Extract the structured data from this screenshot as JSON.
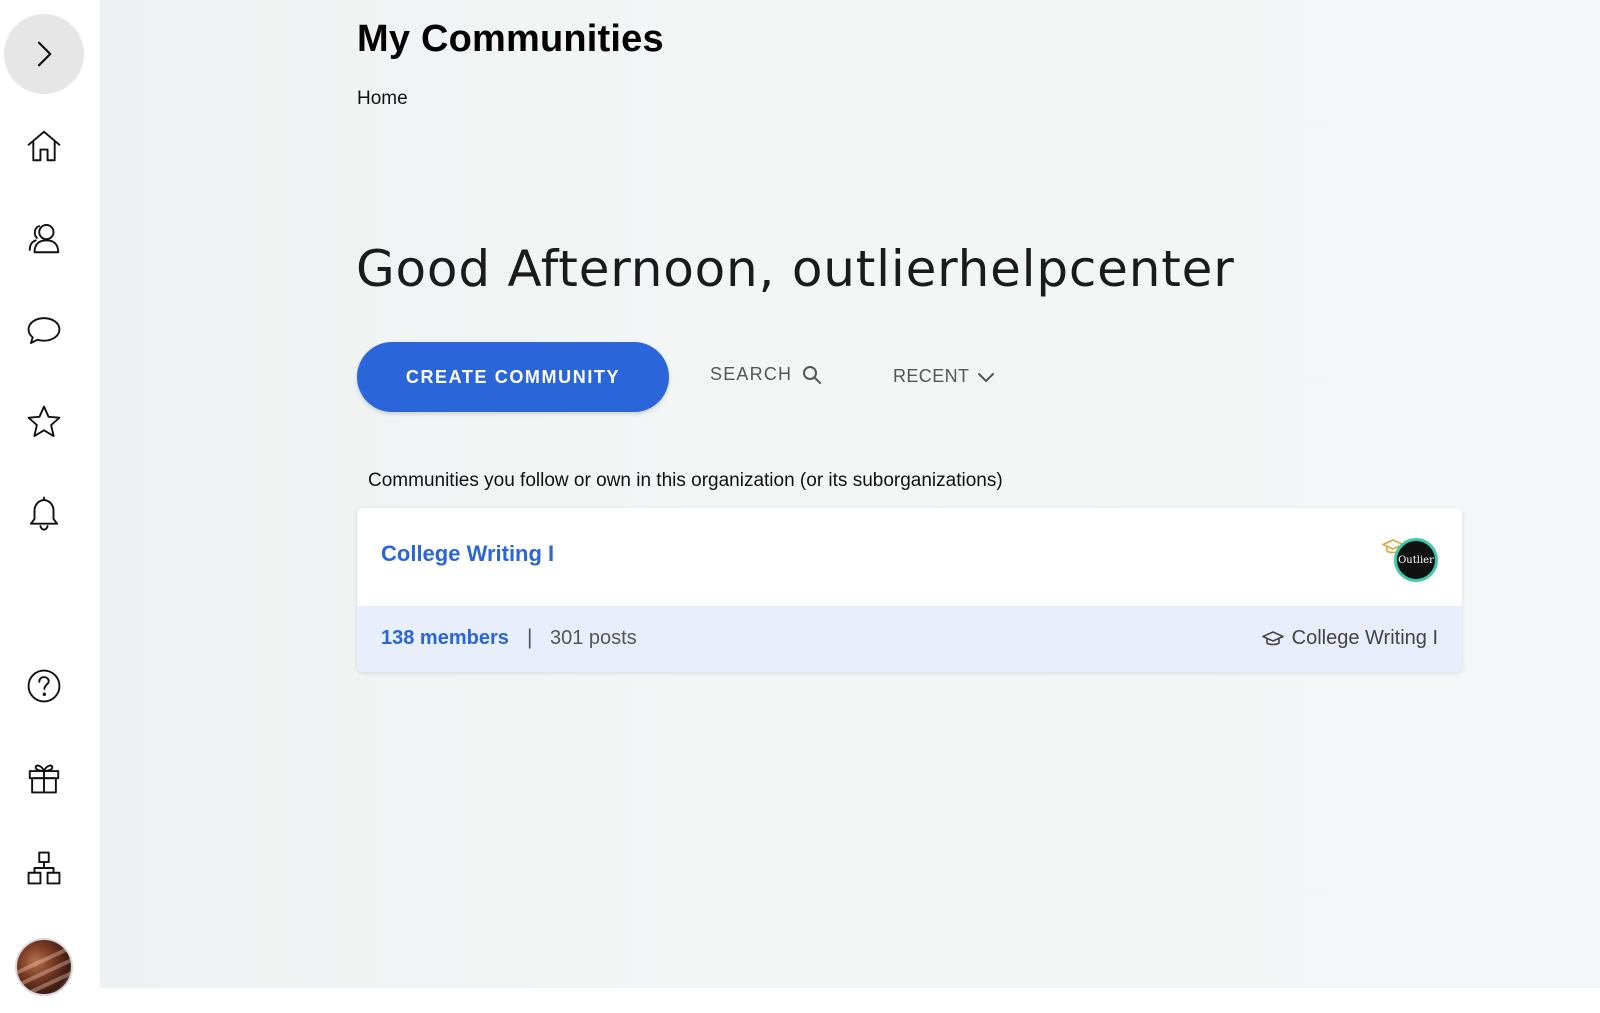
{
  "header": {
    "title": "My Communities",
    "breadcrumb": "Home"
  },
  "greeting": "Good Afternoon, outlierhelpcenter",
  "toolbar": {
    "create_label": "CREATE COMMUNITY",
    "search_label": "SEARCH",
    "sort_label": "RECENT"
  },
  "section_label": "Communities you follow or own in this organization (or its suborganizations)",
  "community": {
    "name": "College Writing I",
    "logo_text": "Outlier",
    "members": "138 members",
    "separator": "|",
    "posts": "301 posts",
    "organization": "College Writing I"
  },
  "sidebar": {
    "icons": [
      "expand-icon",
      "home-icon",
      "people-icon",
      "chat-icon",
      "star-icon",
      "bell-icon",
      "help-icon",
      "gift-icon",
      "hierarchy-icon"
    ]
  },
  "colors": {
    "accent": "#2a66d9",
    "footer_bg": "#e8eefb",
    "logo_ring": "#3dc9a9",
    "badge": "#e0a43a"
  }
}
